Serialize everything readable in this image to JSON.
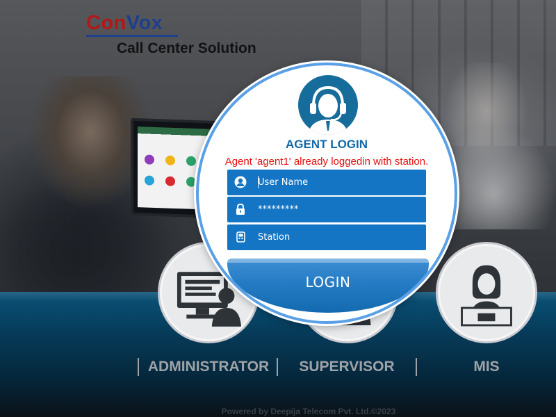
{
  "brand": {
    "name_part1": "Con",
    "name_part2": "Vox",
    "tagline": "Call Center Solution",
    "colors": {
      "con": "#b21818",
      "vox": "#1f3f8c"
    }
  },
  "login": {
    "title": "AGENT LOGIN",
    "error_message": "Agent 'agent1' already loggedin with station.",
    "username": {
      "placeholder": "User Name",
      "value": "",
      "icon": "user-icon"
    },
    "password": {
      "placeholder": "",
      "value": "*********",
      "icon": "lock-icon"
    },
    "station": {
      "placeholder": "Station",
      "value": "",
      "icon": "phone-icon"
    },
    "button_label": "LOGIN",
    "accent_color": "#1375c4"
  },
  "roles": [
    {
      "label": "ADMINISTRATOR",
      "icon": "admin-computer-icon"
    },
    {
      "label": "SUPERVISOR",
      "icon": "supervisor-icon"
    },
    {
      "label": "MIS",
      "icon": "mis-laptop-user-icon"
    }
  ],
  "footer": {
    "text": "Powered by Deepija Telecom Pvt. Ltd.©2023"
  }
}
